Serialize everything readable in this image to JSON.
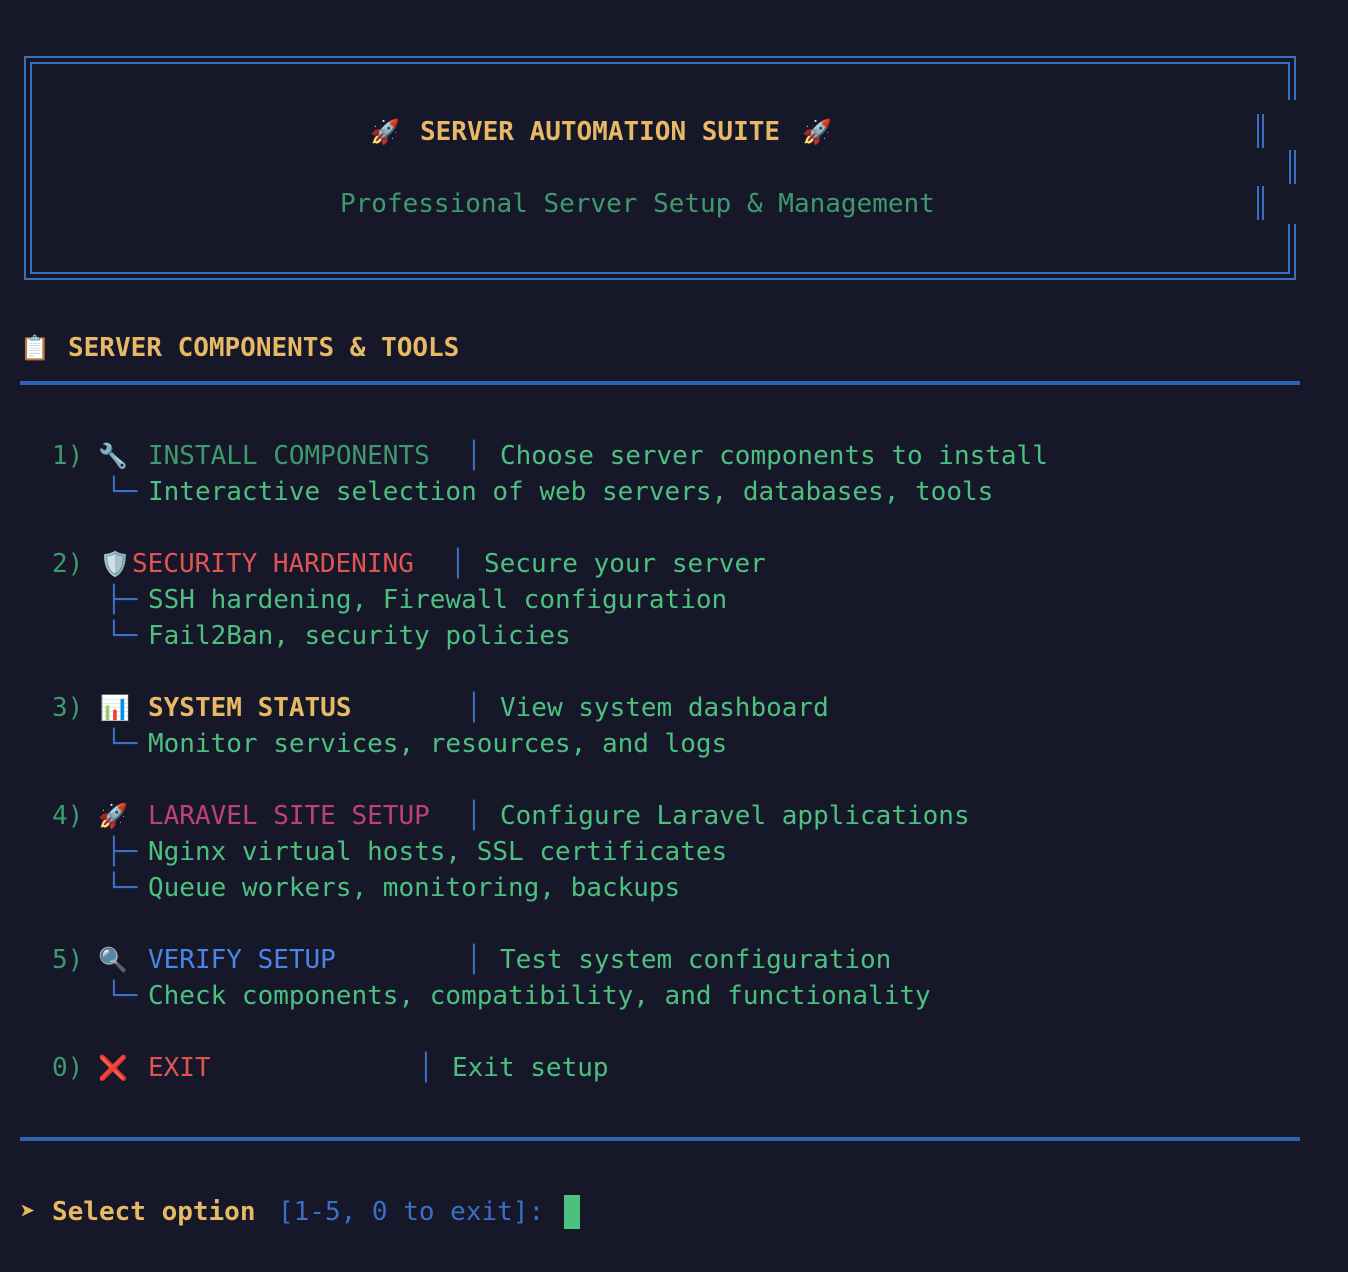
{
  "header": {
    "title_icon": "rocket-icon",
    "title": "SERVER AUTOMATION SUITE",
    "subtitle": "Professional Server Setup & Management"
  },
  "section": {
    "icon": "clipboard-icon",
    "title": "SERVER COMPONENTS & TOOLS"
  },
  "menu": [
    {
      "number": "1)",
      "icon": "wrench-icon",
      "name": "INSTALL COMPONENTS",
      "separator": "│",
      "description": "Choose server components to install",
      "details": [
        {
          "branch": "└─",
          "text": "Interactive selection of web servers, databases, tools"
        }
      ]
    },
    {
      "number": "2)",
      "icon": "shield-icon",
      "name": "SECURITY HARDENING",
      "separator": "│",
      "description": "Secure your server",
      "details": [
        {
          "branch": "├─",
          "text": "SSH hardening, Firewall configuration"
        },
        {
          "branch": "└─",
          "text": "Fail2Ban, security policies"
        }
      ]
    },
    {
      "number": "3)",
      "icon": "bar-chart-icon",
      "name": "SYSTEM STATUS",
      "separator": "│",
      "description": "View system dashboard",
      "details": [
        {
          "branch": "└─",
          "text": "Monitor services, resources, and logs"
        }
      ]
    },
    {
      "number": "4)",
      "icon": "rocket-icon",
      "name": "LARAVEL SITE SETUP",
      "separator": "│",
      "description": "Configure Laravel applications",
      "details": [
        {
          "branch": "├─",
          "text": "Nginx virtual hosts, SSL certificates"
        },
        {
          "branch": "└─",
          "text": "Queue workers, monitoring, backups"
        }
      ]
    },
    {
      "number": "5)",
      "icon": "magnifier-icon",
      "name": "VERIFY SETUP",
      "separator": "│",
      "description": "Test system configuration",
      "details": [
        {
          "branch": "└─",
          "text": "Check components, compatibility, and functionality"
        }
      ]
    },
    {
      "number": "0)",
      "icon": "cross-icon",
      "name": "EXIT",
      "separator": "│",
      "description": "Exit setup",
      "details": []
    }
  ],
  "prompt": {
    "arrow": "➤",
    "label": "Select option",
    "range": "[1-5, 0 to exit]:"
  },
  "colors": {
    "background": "#161829",
    "border": "#3b6fc4",
    "accent_yellow": "#e8b964",
    "text_green": "#4cc07f",
    "security_red": "#e05454",
    "laravel_pink": "#c0407a",
    "verify_blue": "#4a86e8"
  }
}
